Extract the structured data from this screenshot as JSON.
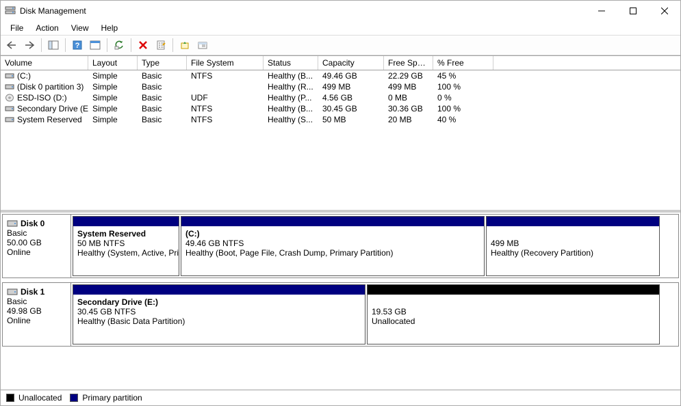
{
  "title": "Disk Management",
  "menu": {
    "file": "File",
    "action": "Action",
    "view": "View",
    "help": "Help"
  },
  "columns": {
    "volume": "Volume",
    "layout": "Layout",
    "type": "Type",
    "fs": "File System",
    "status": "Status",
    "capacity": "Capacity",
    "free": "Free Spa...",
    "pct": "% Free"
  },
  "volumes": [
    {
      "icon": "drive",
      "name": "(C:)",
      "layout": "Simple",
      "type": "Basic",
      "fs": "NTFS",
      "status": "Healthy (B...",
      "capacity": "49.46 GB",
      "free": "22.29 GB",
      "pct": "45 %"
    },
    {
      "icon": "drive",
      "name": "(Disk 0 partition 3)",
      "layout": "Simple",
      "type": "Basic",
      "fs": "",
      "status": "Healthy (R...",
      "capacity": "499 MB",
      "free": "499 MB",
      "pct": "100 %"
    },
    {
      "icon": "cd",
      "name": "ESD-ISO (D:)",
      "layout": "Simple",
      "type": "Basic",
      "fs": "UDF",
      "status": "Healthy (P...",
      "capacity": "4.56 GB",
      "free": "0 MB",
      "pct": "0 %"
    },
    {
      "icon": "drive",
      "name": "Secondary Drive (E:)",
      "layout": "Simple",
      "type": "Basic",
      "fs": "NTFS",
      "status": "Healthy (B...",
      "capacity": "30.45 GB",
      "free": "30.36 GB",
      "pct": "100 %"
    },
    {
      "icon": "drive",
      "name": "System Reserved",
      "layout": "Simple",
      "type": "Basic",
      "fs": "NTFS",
      "status": "Healthy (S...",
      "capacity": "50 MB",
      "free": "20 MB",
      "pct": "40 %"
    }
  ],
  "disks": [
    {
      "name": "Disk 0",
      "type": "Basic",
      "size": "50.00 GB",
      "status": "Online",
      "partitions": [
        {
          "style": "primary",
          "widthPx": 156,
          "title": "System Reserved",
          "line2": "50 MB NTFS",
          "line3": "Healthy (System, Active, Pri"
        },
        {
          "style": "primary",
          "widthPx": 444,
          "title": "(C:)",
          "line2": "49.46 GB NTFS",
          "line3": "Healthy (Boot, Page File, Crash Dump, Primary Partition)"
        },
        {
          "style": "primary",
          "widthPx": 254,
          "title": "",
          "line2": "499 MB",
          "line3": "Healthy (Recovery Partition)"
        }
      ]
    },
    {
      "name": "Disk 1",
      "type": "Basic",
      "size": "49.98 GB",
      "status": "Online",
      "partitions": [
        {
          "style": "primary",
          "widthPx": 428,
          "title": "Secondary Drive  (E:)",
          "line2": "30.45 GB NTFS",
          "line3": "Healthy (Basic Data Partition)"
        },
        {
          "style": "unalloc",
          "widthPx": 428,
          "title": "",
          "line2": "19.53 GB",
          "line3": "Unallocated"
        }
      ]
    }
  ],
  "legend": {
    "unallocated": "Unallocated",
    "primary": "Primary partition"
  },
  "colors": {
    "primary": "#000080",
    "unallocated": "#000000"
  }
}
